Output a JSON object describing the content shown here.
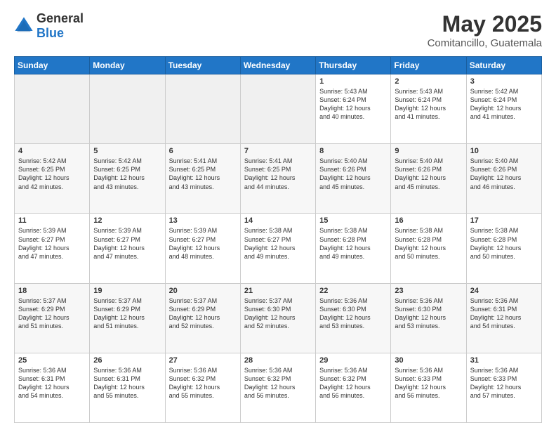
{
  "logo": {
    "general": "General",
    "blue": "Blue"
  },
  "header": {
    "title": "May 2025",
    "subtitle": "Comitancillo, Guatemala"
  },
  "days_of_week": [
    "Sunday",
    "Monday",
    "Tuesday",
    "Wednesday",
    "Thursday",
    "Friday",
    "Saturday"
  ],
  "weeks": [
    [
      {
        "day": "",
        "info": "",
        "empty": true
      },
      {
        "day": "",
        "info": "",
        "empty": true
      },
      {
        "day": "",
        "info": "",
        "empty": true
      },
      {
        "day": "",
        "info": "",
        "empty": true
      },
      {
        "day": "1",
        "info": "Sunrise: 5:43 AM\nSunset: 6:24 PM\nDaylight: 12 hours\nand 40 minutes.",
        "empty": false
      },
      {
        "day": "2",
        "info": "Sunrise: 5:43 AM\nSunset: 6:24 PM\nDaylight: 12 hours\nand 41 minutes.",
        "empty": false
      },
      {
        "day": "3",
        "info": "Sunrise: 5:42 AM\nSunset: 6:24 PM\nDaylight: 12 hours\nand 41 minutes.",
        "empty": false
      }
    ],
    [
      {
        "day": "4",
        "info": "Sunrise: 5:42 AM\nSunset: 6:25 PM\nDaylight: 12 hours\nand 42 minutes.",
        "empty": false
      },
      {
        "day": "5",
        "info": "Sunrise: 5:42 AM\nSunset: 6:25 PM\nDaylight: 12 hours\nand 43 minutes.",
        "empty": false
      },
      {
        "day": "6",
        "info": "Sunrise: 5:41 AM\nSunset: 6:25 PM\nDaylight: 12 hours\nand 43 minutes.",
        "empty": false
      },
      {
        "day": "7",
        "info": "Sunrise: 5:41 AM\nSunset: 6:25 PM\nDaylight: 12 hours\nand 44 minutes.",
        "empty": false
      },
      {
        "day": "8",
        "info": "Sunrise: 5:40 AM\nSunset: 6:26 PM\nDaylight: 12 hours\nand 45 minutes.",
        "empty": false
      },
      {
        "day": "9",
        "info": "Sunrise: 5:40 AM\nSunset: 6:26 PM\nDaylight: 12 hours\nand 45 minutes.",
        "empty": false
      },
      {
        "day": "10",
        "info": "Sunrise: 5:40 AM\nSunset: 6:26 PM\nDaylight: 12 hours\nand 46 minutes.",
        "empty": false
      }
    ],
    [
      {
        "day": "11",
        "info": "Sunrise: 5:39 AM\nSunset: 6:27 PM\nDaylight: 12 hours\nand 47 minutes.",
        "empty": false
      },
      {
        "day": "12",
        "info": "Sunrise: 5:39 AM\nSunset: 6:27 PM\nDaylight: 12 hours\nand 47 minutes.",
        "empty": false
      },
      {
        "day": "13",
        "info": "Sunrise: 5:39 AM\nSunset: 6:27 PM\nDaylight: 12 hours\nand 48 minutes.",
        "empty": false
      },
      {
        "day": "14",
        "info": "Sunrise: 5:38 AM\nSunset: 6:27 PM\nDaylight: 12 hours\nand 49 minutes.",
        "empty": false
      },
      {
        "day": "15",
        "info": "Sunrise: 5:38 AM\nSunset: 6:28 PM\nDaylight: 12 hours\nand 49 minutes.",
        "empty": false
      },
      {
        "day": "16",
        "info": "Sunrise: 5:38 AM\nSunset: 6:28 PM\nDaylight: 12 hours\nand 50 minutes.",
        "empty": false
      },
      {
        "day": "17",
        "info": "Sunrise: 5:38 AM\nSunset: 6:28 PM\nDaylight: 12 hours\nand 50 minutes.",
        "empty": false
      }
    ],
    [
      {
        "day": "18",
        "info": "Sunrise: 5:37 AM\nSunset: 6:29 PM\nDaylight: 12 hours\nand 51 minutes.",
        "empty": false
      },
      {
        "day": "19",
        "info": "Sunrise: 5:37 AM\nSunset: 6:29 PM\nDaylight: 12 hours\nand 51 minutes.",
        "empty": false
      },
      {
        "day": "20",
        "info": "Sunrise: 5:37 AM\nSunset: 6:29 PM\nDaylight: 12 hours\nand 52 minutes.",
        "empty": false
      },
      {
        "day": "21",
        "info": "Sunrise: 5:37 AM\nSunset: 6:30 PM\nDaylight: 12 hours\nand 52 minutes.",
        "empty": false
      },
      {
        "day": "22",
        "info": "Sunrise: 5:36 AM\nSunset: 6:30 PM\nDaylight: 12 hours\nand 53 minutes.",
        "empty": false
      },
      {
        "day": "23",
        "info": "Sunrise: 5:36 AM\nSunset: 6:30 PM\nDaylight: 12 hours\nand 53 minutes.",
        "empty": false
      },
      {
        "day": "24",
        "info": "Sunrise: 5:36 AM\nSunset: 6:31 PM\nDaylight: 12 hours\nand 54 minutes.",
        "empty": false
      }
    ],
    [
      {
        "day": "25",
        "info": "Sunrise: 5:36 AM\nSunset: 6:31 PM\nDaylight: 12 hours\nand 54 minutes.",
        "empty": false
      },
      {
        "day": "26",
        "info": "Sunrise: 5:36 AM\nSunset: 6:31 PM\nDaylight: 12 hours\nand 55 minutes.",
        "empty": false
      },
      {
        "day": "27",
        "info": "Sunrise: 5:36 AM\nSunset: 6:32 PM\nDaylight: 12 hours\nand 55 minutes.",
        "empty": false
      },
      {
        "day": "28",
        "info": "Sunrise: 5:36 AM\nSunset: 6:32 PM\nDaylight: 12 hours\nand 56 minutes.",
        "empty": false
      },
      {
        "day": "29",
        "info": "Sunrise: 5:36 AM\nSunset: 6:32 PM\nDaylight: 12 hours\nand 56 minutes.",
        "empty": false
      },
      {
        "day": "30",
        "info": "Sunrise: 5:36 AM\nSunset: 6:33 PM\nDaylight: 12 hours\nand 56 minutes.",
        "empty": false
      },
      {
        "day": "31",
        "info": "Sunrise: 5:36 AM\nSunset: 6:33 PM\nDaylight: 12 hours\nand 57 minutes.",
        "empty": false
      }
    ]
  ]
}
